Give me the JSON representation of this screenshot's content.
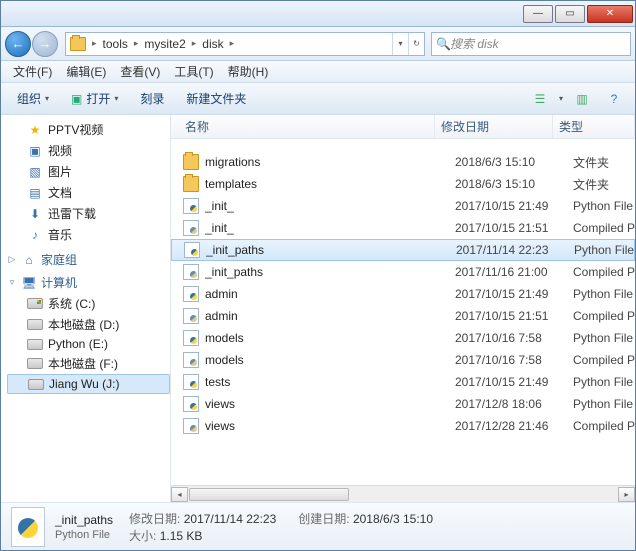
{
  "titlebar": {
    "min": "—",
    "max": "▭",
    "close": "✕"
  },
  "nav": {
    "back": "←",
    "fwd": "→",
    "path": [
      "tools",
      "mysite2",
      "disk"
    ],
    "refresh": "↻",
    "search_placeholder": "搜索 disk"
  },
  "menu": {
    "file": "文件(F)",
    "edit": "编辑(E)",
    "view": "查看(V)",
    "tools": "工具(T)",
    "help": "帮助(H)"
  },
  "toolbar": {
    "organize": "组织",
    "open": "打开",
    "burn": "刻录",
    "newfolder": "新建文件夹",
    "view": "☰",
    "preview": "▥",
    "help": "?"
  },
  "sidebar": {
    "fav_items": [
      {
        "label": "PPTV视频",
        "icon": "ic-star"
      },
      {
        "label": "视频",
        "icon": "ic-vid"
      },
      {
        "label": "图片",
        "icon": "ic-pic"
      },
      {
        "label": "文档",
        "icon": "ic-doc"
      },
      {
        "label": "迅雷下载",
        "icon": "ic-dl"
      },
      {
        "label": "音乐",
        "icon": "ic-mus"
      }
    ],
    "homegroup": "家庭组",
    "computer": "计算机",
    "drives": [
      {
        "label": "系统 (C:)",
        "win": true
      },
      {
        "label": "本地磁盘 (D:)",
        "win": false
      },
      {
        "label": "Python (E:)",
        "win": false
      },
      {
        "label": "本地磁盘 (F:)",
        "win": false
      },
      {
        "label": "Jiang Wu (J:)",
        "win": false,
        "sel": true
      }
    ]
  },
  "columns": {
    "name": "名称",
    "date": "修改日期",
    "type": "类型"
  },
  "files": [
    {
      "icon": "ic-folder",
      "name": "migrations",
      "date": "2018/6/3 15:10",
      "type": "文件夹"
    },
    {
      "icon": "ic-folder",
      "name": "templates",
      "date": "2018/6/3 15:10",
      "type": "文件夹"
    },
    {
      "icon": "ic-py",
      "name": "_init_",
      "date": "2017/10/15 21:49",
      "type": "Python File"
    },
    {
      "icon": "ic-pyc",
      "name": "_init_",
      "date": "2017/10/15 21:51",
      "type": "Compiled Python File"
    },
    {
      "icon": "ic-py",
      "name": "_init_paths",
      "date": "2017/11/14 22:23",
      "type": "Python File",
      "sel": true
    },
    {
      "icon": "ic-pyc",
      "name": "_init_paths",
      "date": "2017/11/16 21:00",
      "type": "Compiled Python File"
    },
    {
      "icon": "ic-py",
      "name": "admin",
      "date": "2017/10/15 21:49",
      "type": "Python File"
    },
    {
      "icon": "ic-pyc",
      "name": "admin",
      "date": "2017/10/15 21:51",
      "type": "Compiled Python File"
    },
    {
      "icon": "ic-py",
      "name": "models",
      "date": "2017/10/16 7:58",
      "type": "Python File"
    },
    {
      "icon": "ic-pyc",
      "name": "models",
      "date": "2017/10/16 7:58",
      "type": "Compiled Python File"
    },
    {
      "icon": "ic-py",
      "name": "tests",
      "date": "2017/10/15 21:49",
      "type": "Python File"
    },
    {
      "icon": "ic-py",
      "name": "views",
      "date": "2017/12/8 18:06",
      "type": "Python File"
    },
    {
      "icon": "ic-pyc",
      "name": "views",
      "date": "2017/12/28 21:46",
      "type": "Compiled Python File"
    }
  ],
  "details": {
    "filename": "_init_paths",
    "filetype": "Python File",
    "mod_label": "修改日期:",
    "mod_val": "2017/11/14 22:23",
    "size_label": "大小:",
    "size_val": "1.15 KB",
    "created_label": "创建日期:",
    "created_val": "2018/6/3 15:10"
  }
}
